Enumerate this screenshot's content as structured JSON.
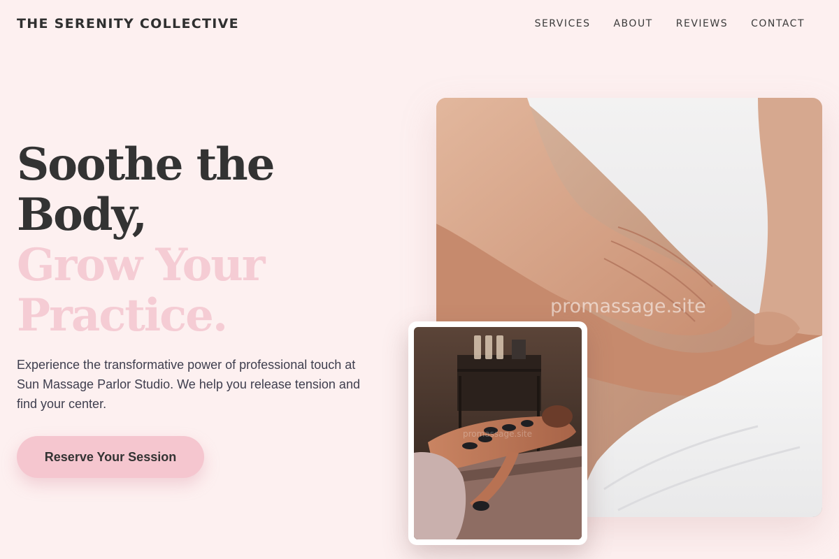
{
  "header": {
    "brand": "THE SERENITY COLLECTIVE",
    "nav": [
      {
        "label": "SERVICES"
      },
      {
        "label": "ABOUT"
      },
      {
        "label": "REVIEWS"
      },
      {
        "label": "CONTACT"
      }
    ]
  },
  "hero": {
    "headline_line1": "Soothe the",
    "headline_line2": "Body,",
    "headline_accent_line1": "Grow Your",
    "headline_accent_line2": "Practice.",
    "description": "Experience the transformative power of professional touch at Sun Massage Parlor Studio. We help you release tension and find your center.",
    "cta_label": "Reserve Your Session"
  },
  "images": {
    "main_watermark": "promassage.site",
    "inset_watermark": "promassage.site"
  },
  "colors": {
    "background": "#fdf0f0",
    "accent_pink": "#f5ccd4",
    "button": "#f5c6cf",
    "text_dark": "#333333"
  }
}
